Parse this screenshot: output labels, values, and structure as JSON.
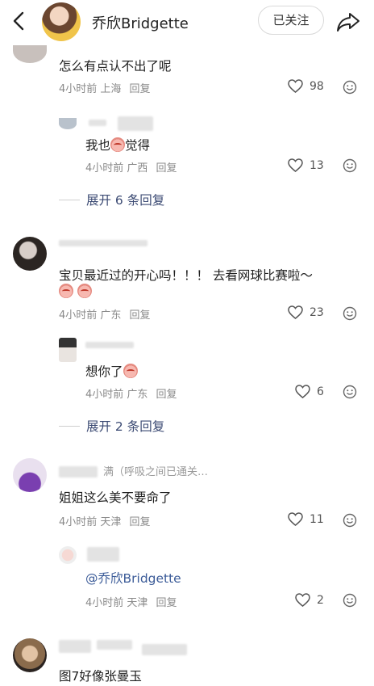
{
  "header": {
    "name": "乔欣Bridgette",
    "follow_label": "已关注"
  },
  "comments": [
    {
      "text": "怎么有点认不出了呢",
      "time": "4小时前",
      "location": "上海",
      "reply_label": "回复",
      "likes": "98",
      "replies": [
        {
          "text_before": "我也",
          "text_after": "觉得",
          "time": "4小时前",
          "location": "广西",
          "reply_label": "回复",
          "likes": "13"
        }
      ],
      "expand_label": "展开 6 条回复"
    },
    {
      "text": "宝贝最近过的开心吗！！！ 去看网球比赛啦～",
      "time": "4小时前",
      "location": "广东",
      "reply_label": "回复",
      "likes": "23",
      "replies": [
        {
          "text": "想你了",
          "time": "4小时前",
          "location": "广东",
          "reply_label": "回复",
          "likes": "6"
        }
      ],
      "expand_label": "展开 2 条回复"
    },
    {
      "username_partial": "满（呼吸之间已通关…",
      "text": "姐姐这么美不要命了",
      "time": "4小时前",
      "location": "天津",
      "reply_label": "回复",
      "likes": "11",
      "replies": [
        {
          "text": "@乔欣Bridgette",
          "time": "4小时前",
          "location": "天津",
          "reply_label": "回复",
          "likes": "2"
        }
      ]
    },
    {
      "text": "图7好像张曼玉"
    }
  ]
}
